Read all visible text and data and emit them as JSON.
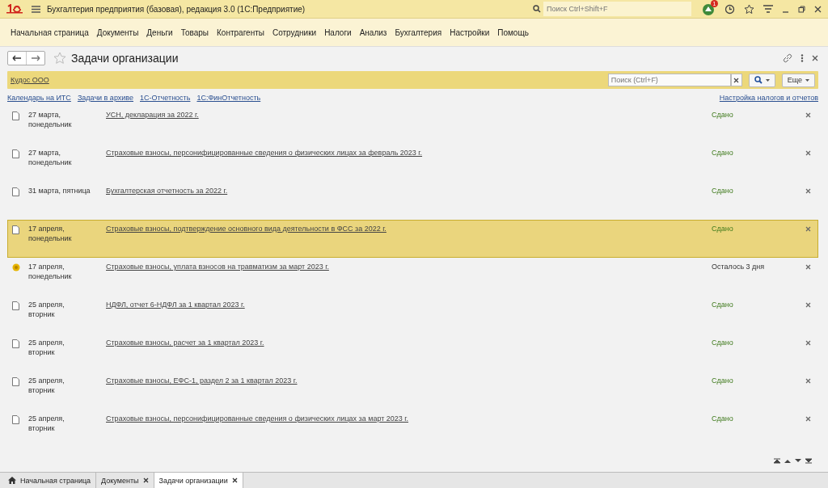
{
  "window": {
    "title": "Бухгалтерия предприятия (базовая), редакция 3.0  (1С:Предприятие)",
    "search_placeholder": "Поиск Ctrl+Shift+F",
    "notification_count": "1"
  },
  "menu": [
    "Начальная страница",
    "Документы",
    "Деньги",
    "Товары",
    "Контрагенты",
    "Сотрудники",
    "Налоги",
    "Анализ",
    "Бухгалтерия",
    "Настройки",
    "Помощь"
  ],
  "form": {
    "title": "Задачи организации",
    "organization": "Кудос ООО",
    "search_placeholder": "Поиск (Ctrl+F)",
    "more_button": "Еще",
    "links": [
      "Календарь на ИТС",
      "Задачи в архиве",
      "1С-Отчетность",
      "1С:ФинОтчетность"
    ],
    "settings_link": "Настройка налогов и отчетов"
  },
  "tasks": [
    {
      "date": [
        "27 марта,",
        "понедельник"
      ],
      "title": "УСН, декларация за 2022 г.",
      "status": "Сдано",
      "kind": "done",
      "selected": false
    },
    {
      "date": [
        "27 марта,",
        "понедельник"
      ],
      "title": "Страховые взносы, персонифицированные сведения о физических лицах за февраль 2023 г.",
      "status": "Сдано",
      "kind": "done",
      "selected": false
    },
    {
      "date": [
        "31 марта, пятница"
      ],
      "title": "Бухгалтерская отчетность за 2022 г.",
      "status": "Сдано",
      "kind": "done",
      "selected": false
    },
    {
      "date": [
        "17 апреля,",
        "понедельник"
      ],
      "title": "Страховые взносы, подтверждение основного вида деятельности в ФСС за 2022 г.",
      "status": "Сдано",
      "kind": "done",
      "selected": true
    },
    {
      "date": [
        "17 апреля,",
        "понедельник"
      ],
      "title": "Страховые взносы, уплата взносов на травматизм за март 2023 г.",
      "status": "Осталось 3 дня",
      "kind": "payment",
      "selected": false
    },
    {
      "date": [
        "25 апреля,",
        "вторник"
      ],
      "title": "НДФЛ, отчет 6-НДФЛ за 1 квартал 2023 г.",
      "status": "Сдано",
      "kind": "done",
      "selected": false
    },
    {
      "date": [
        "25 апреля,",
        "вторник"
      ],
      "title": "Страховые взносы, расчет за 1 квартал 2023 г.",
      "status": "Сдано",
      "kind": "done",
      "selected": false
    },
    {
      "date": [
        "25 апреля,",
        "вторник"
      ],
      "title": "Страховые взносы, ЕФС-1, раздел 2 за 1 квартал 2023 г.",
      "status": "Сдано",
      "kind": "done",
      "selected": false
    },
    {
      "date": [
        "25 апреля,",
        "вторник"
      ],
      "title": "Страховые взносы, персонифицированные сведения о физических лицах за март 2023 г.",
      "status": "Сдано",
      "kind": "done",
      "selected": false
    }
  ],
  "open_windows": [
    {
      "label": "Начальная страница",
      "kind": "home",
      "selected": false
    },
    {
      "label": "Документы",
      "kind": "closable",
      "selected": false
    },
    {
      "label": "Задачи организации",
      "kind": "closable",
      "selected": true
    }
  ]
}
